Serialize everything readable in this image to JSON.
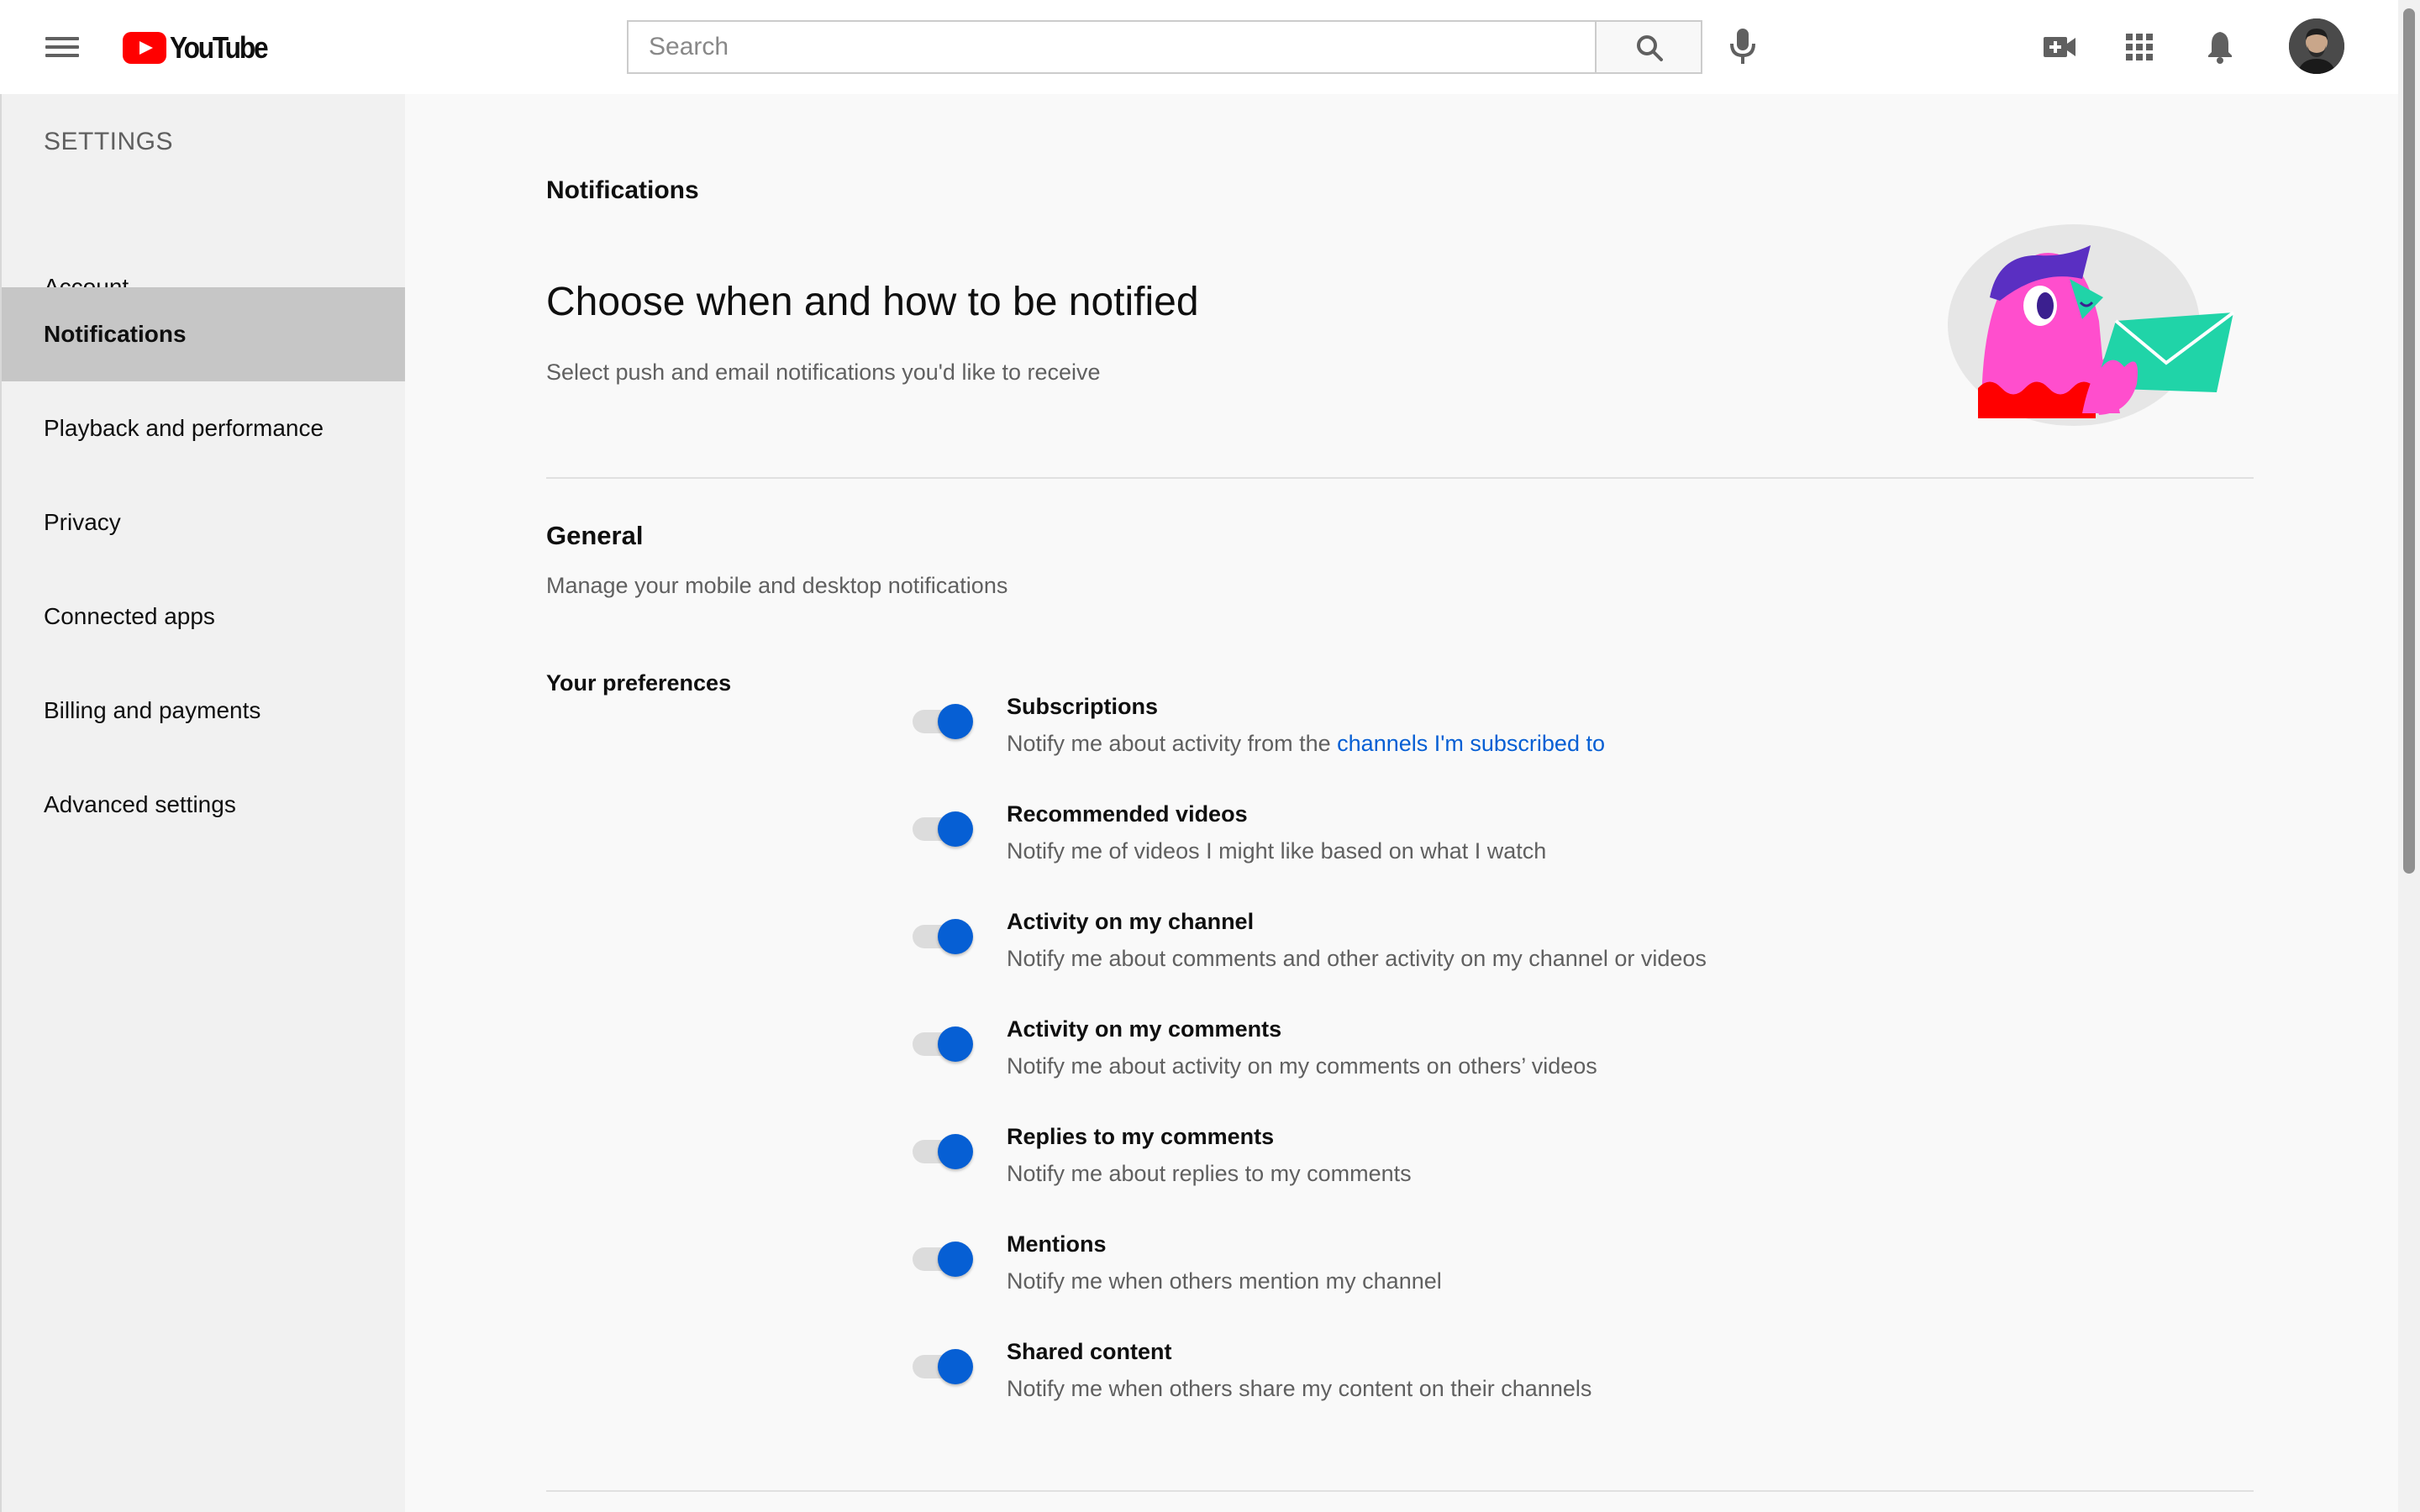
{
  "header": {
    "logo_text": "YouTube",
    "search": {
      "placeholder": "Search",
      "value": ""
    },
    "icons": [
      "menu-icon",
      "search-icon",
      "mic-icon",
      "create-video-icon",
      "apps-grid-icon",
      "notifications-bell-icon",
      "avatar"
    ]
  },
  "sidebar": {
    "title": "SETTINGS",
    "items": [
      {
        "label": "Account",
        "active": false
      },
      {
        "label": "Notifications",
        "active": true
      },
      {
        "label": "Playback and performance",
        "active": false
      },
      {
        "label": "Privacy",
        "active": false
      },
      {
        "label": "Connected apps",
        "active": false
      },
      {
        "label": "Billing and payments",
        "active": false
      },
      {
        "label": "Advanced settings",
        "active": false
      }
    ]
  },
  "main": {
    "page_label": "Notifications",
    "heading": "Choose when and how to be notified",
    "subheading": "Select push and email notifications you'd like to receive",
    "general": {
      "title": "General",
      "subtitle": "Manage your mobile and desktop notifications",
      "preferences_label": "Your preferences",
      "preferences": [
        {
          "title": "Subscriptions",
          "desc": "Notify me about activity from the ",
          "link": "channels I'm subscribed to",
          "enabled": true
        },
        {
          "title": "Recommended videos",
          "desc": "Notify me of videos I might like based on what I watch",
          "enabled": true
        },
        {
          "title": "Activity on my channel",
          "desc": "Notify me about comments and other activity on my channel or videos",
          "enabled": true
        },
        {
          "title": "Activity on my comments",
          "desc": "Notify me about activity on my comments on others’ videos",
          "enabled": true
        },
        {
          "title": "Replies to my comments",
          "desc": "Notify me about replies to my comments",
          "enabled": true
        },
        {
          "title": "Mentions",
          "desc": "Notify me when others mention my channel",
          "enabled": true
        },
        {
          "title": "Shared content",
          "desc": "Notify me when others share my content on their channels",
          "enabled": true
        }
      ]
    }
  },
  "colors": {
    "brand_red": "#ff0000",
    "toggle_on": "#065fd4",
    "link": "#065fd4",
    "active_sidebar": "#c6c6c6"
  }
}
